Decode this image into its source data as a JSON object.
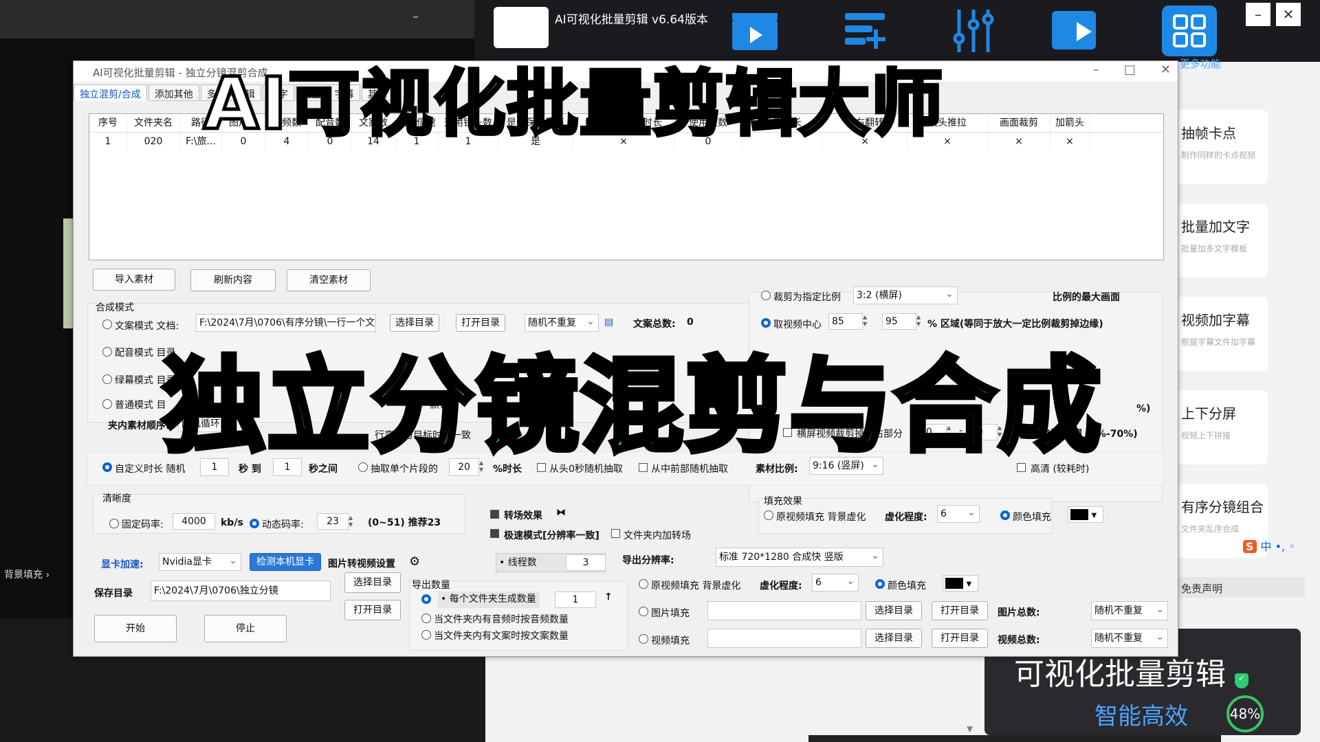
{
  "background_left": {
    "minimize": "–",
    "label": "背景填充"
  },
  "background_right": {
    "app_title": "AI可视化批量剪辑 v6.64版本",
    "win_min": "–",
    "win_close": "✕",
    "toolbar_label": "更多功能",
    "features": [
      {
        "title": "抽帧卡点",
        "sub": "制作同样的卡点视频"
      },
      {
        "title": "批量加文字",
        "sub": "批量加多文字模板"
      },
      {
        "title": "视频加字幕",
        "sub": "根据字幕文件加字幕"
      },
      {
        "title": "上下分屏",
        "sub": "视频上下拼接"
      },
      {
        "title": "有序分镜组合",
        "sub": "文件夹乱序合成"
      }
    ],
    "duty": "免责声明",
    "promo_line1": "可视化批量剪辑",
    "promo_line2": "智能高效",
    "ime": "中 •, ◦",
    "gauge": "48%"
  },
  "window": {
    "title": "AI可视化批量剪辑 - 独立分镜混剪合成",
    "min": "–",
    "max": "□",
    "close": "✕",
    "tabs": [
      "独立混剪/合成",
      "添加其他",
      "多镜头剪辑",
      "加字",
      "批量",
      "字幕",
      "其他"
    ]
  },
  "table": {
    "headers": [
      "序号",
      "文件夹名",
      "路径",
      "图片数",
      "视频数",
      "配音数",
      "文案数",
      "视频倍速",
      "选用镜头数",
      "是否保留原声",
      "每个素材抽帧时长",
      "使用次数",
      "设定时长",
      "左右翻转",
      "镜头推拉",
      "画面裁剪",
      "加箭头"
    ],
    "rows": [
      [
        "1",
        "020",
        "F:\\旅...",
        "0",
        "4",
        "0",
        "14",
        "1",
        "1",
        "是",
        "×",
        "0",
        "",
        "×",
        "×",
        "×",
        "×"
      ]
    ]
  },
  "buttons": {
    "import": "导入素材",
    "refresh": "刷新内容",
    "clear": "清空素材",
    "select_dir": "选择目录",
    "open_dir": "打开目录",
    "start": "开始",
    "stop": "停止",
    "detect_gpu": "检测本机显卡"
  },
  "compose": {
    "section": "合成模式",
    "mode_text": "文案模式 文档:",
    "mode_text_path": "F:\\2024\\7月\\0706\\有序分镜\\一行一个文",
    "mode_text_order": "随机不重复",
    "text_total_label": "文案总数:",
    "text_total": "0",
    "mode_audio": "配音模式 目录",
    "mode_green": "绿幕模式 目录",
    "mode_green_path": "03\\",
    "mode_normal": "普通模式 目",
    "order_label": "夹内素材顺序:",
    "order_value": "随机循环",
    "same_speed": "行变速与目标时长一致",
    "default_lbl": "默认"
  },
  "crop": {
    "crop_ratio_label": "裁剪为指定比例",
    "crop_ratio_value": "3:2 (横屏)",
    "max_frame": "比例的最大画面",
    "center_label": "取视频中心",
    "center_a": "85",
    "center_b": "95",
    "center_tail": "% 区域(等同于放大一定比例裁剪掉边缘)",
    "random_tail": "%之间随机 范围 (1%-70%)",
    "landscape_label": "横屏视频裁剪掉左右部分",
    "landscape_a": "20",
    "landscape_b": "30",
    "range_tail2": "%)"
  },
  "duration": {
    "custom_label": "自定义时长 随机",
    "from": "1",
    "sec_to": "秒 到",
    "to": "1",
    "between": "秒之间",
    "extract_label": "抽取单个片段的",
    "extract_pct": "20",
    "extract_tail": "%时长",
    "head_random": "从头0秒随机抽取",
    "mid_random": "从中前部随机抽取"
  },
  "material_ratio": {
    "label": "素材比例:",
    "value": "9:16 (竖屏)",
    "hd": "高清 (较耗时)"
  },
  "fill": {
    "section": "填充效果",
    "orig_fill": "原视频填充 背景虚化",
    "blur_label": "虚化程度:",
    "blur_value": "6",
    "color_fill": "颜色填充"
  },
  "quality": {
    "section": "清晰度",
    "fixed_label": "固定码率:",
    "fixed_value": "4000",
    "unit": "kb/s",
    "dynamic_label": "动态码率:",
    "dynamic_value": "23",
    "hint": "(0~51) 推荐23"
  },
  "effects": {
    "transition": "转场效果",
    "fast_mode": "极速模式[分辨率一致]",
    "folder_transition": "文件夹内加转场",
    "threads_label": "线程数",
    "threads": "3"
  },
  "gpu": {
    "label": "显卡加速:",
    "value": "Nvidia显卡",
    "pic_to_video": "图片转视频设置"
  },
  "save": {
    "label": "保存目录",
    "path": "F:\\2024\\7月\\0706\\独立分镜"
  },
  "export": {
    "res_label": "导出分辨率:",
    "res_value": "标准 720*1280 合成快 竖版",
    "count_section": "导出数量",
    "per_folder": "每个文件夹生成数量",
    "per_folder_value": "1",
    "up_arrow": "↑",
    "by_audio": "当文件夹内有音频时按音频数量",
    "by_text": "当文件夹内有文案时按文案数量",
    "orig_fill2": "原视频填充 背景虚化",
    "blur_label2": "虚化程度:",
    "blur_value2": "6",
    "color_fill2": "颜色填充",
    "pic_fill": "图片填充",
    "video_fill": "视频填充",
    "pic_total": "图片总数:",
    "video_total": "视频总数:",
    "random_no_repeat": "随机不重复"
  },
  "overlay": {
    "headline": "AI可视化批量剪辑大师",
    "subheadline": "独立分镜混剪与合成"
  },
  "colors": {
    "accent": "#0a64d8",
    "overlay_cyan": "#23d9f4"
  }
}
